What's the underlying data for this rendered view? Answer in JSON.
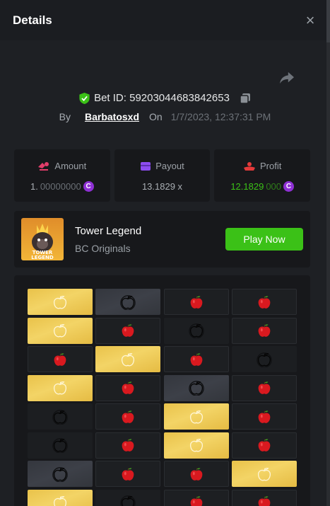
{
  "header": {
    "title": "Details",
    "close_icon": "close-icon"
  },
  "bet": {
    "id_label": "Bet ID: 59203044683842653",
    "by_label": "By",
    "username": "Barbatosxd",
    "on_label": "On",
    "datetime": "1/7/2023, 12:37:31 PM"
  },
  "stats": {
    "amount": {
      "label": "Amount",
      "value_main": "1.",
      "value_dim": "00000000",
      "icon": "coin-hand-icon",
      "color": "#e13d6a"
    },
    "payout": {
      "label": "Payout",
      "value": "13.1829 x",
      "icon": "wallet-icon",
      "color": "#8d4cf1"
    },
    "profit": {
      "label": "Profit",
      "value_main": "12.1829",
      "value_dim": "000",
      "icon": "hand-coin-icon",
      "color": "#e43a3a"
    }
  },
  "game": {
    "name": "Tower Legend",
    "provider": "BC Originals",
    "play_label": "Play Now",
    "thumb_text": "TOWER LEGEND"
  },
  "board": {
    "rows": [
      [
        "gold",
        "grey",
        "apple",
        "apple"
      ],
      [
        "gold",
        "apple",
        "black",
        "apple"
      ],
      [
        "apple",
        "gold",
        "apple",
        "black"
      ],
      [
        "gold",
        "apple",
        "grey",
        "apple"
      ],
      [
        "black",
        "apple",
        "gold",
        "apple"
      ],
      [
        "black",
        "apple",
        "gold",
        "apple"
      ],
      [
        "grey",
        "apple",
        "apple",
        "gold"
      ],
      [
        "gold",
        "black",
        "apple",
        "apple"
      ]
    ]
  },
  "colors": {
    "accent_green": "#3bc117",
    "coin_purple": "#8e30d4",
    "gold": "#f0cf5c",
    "apple_red": "#d9191f"
  }
}
